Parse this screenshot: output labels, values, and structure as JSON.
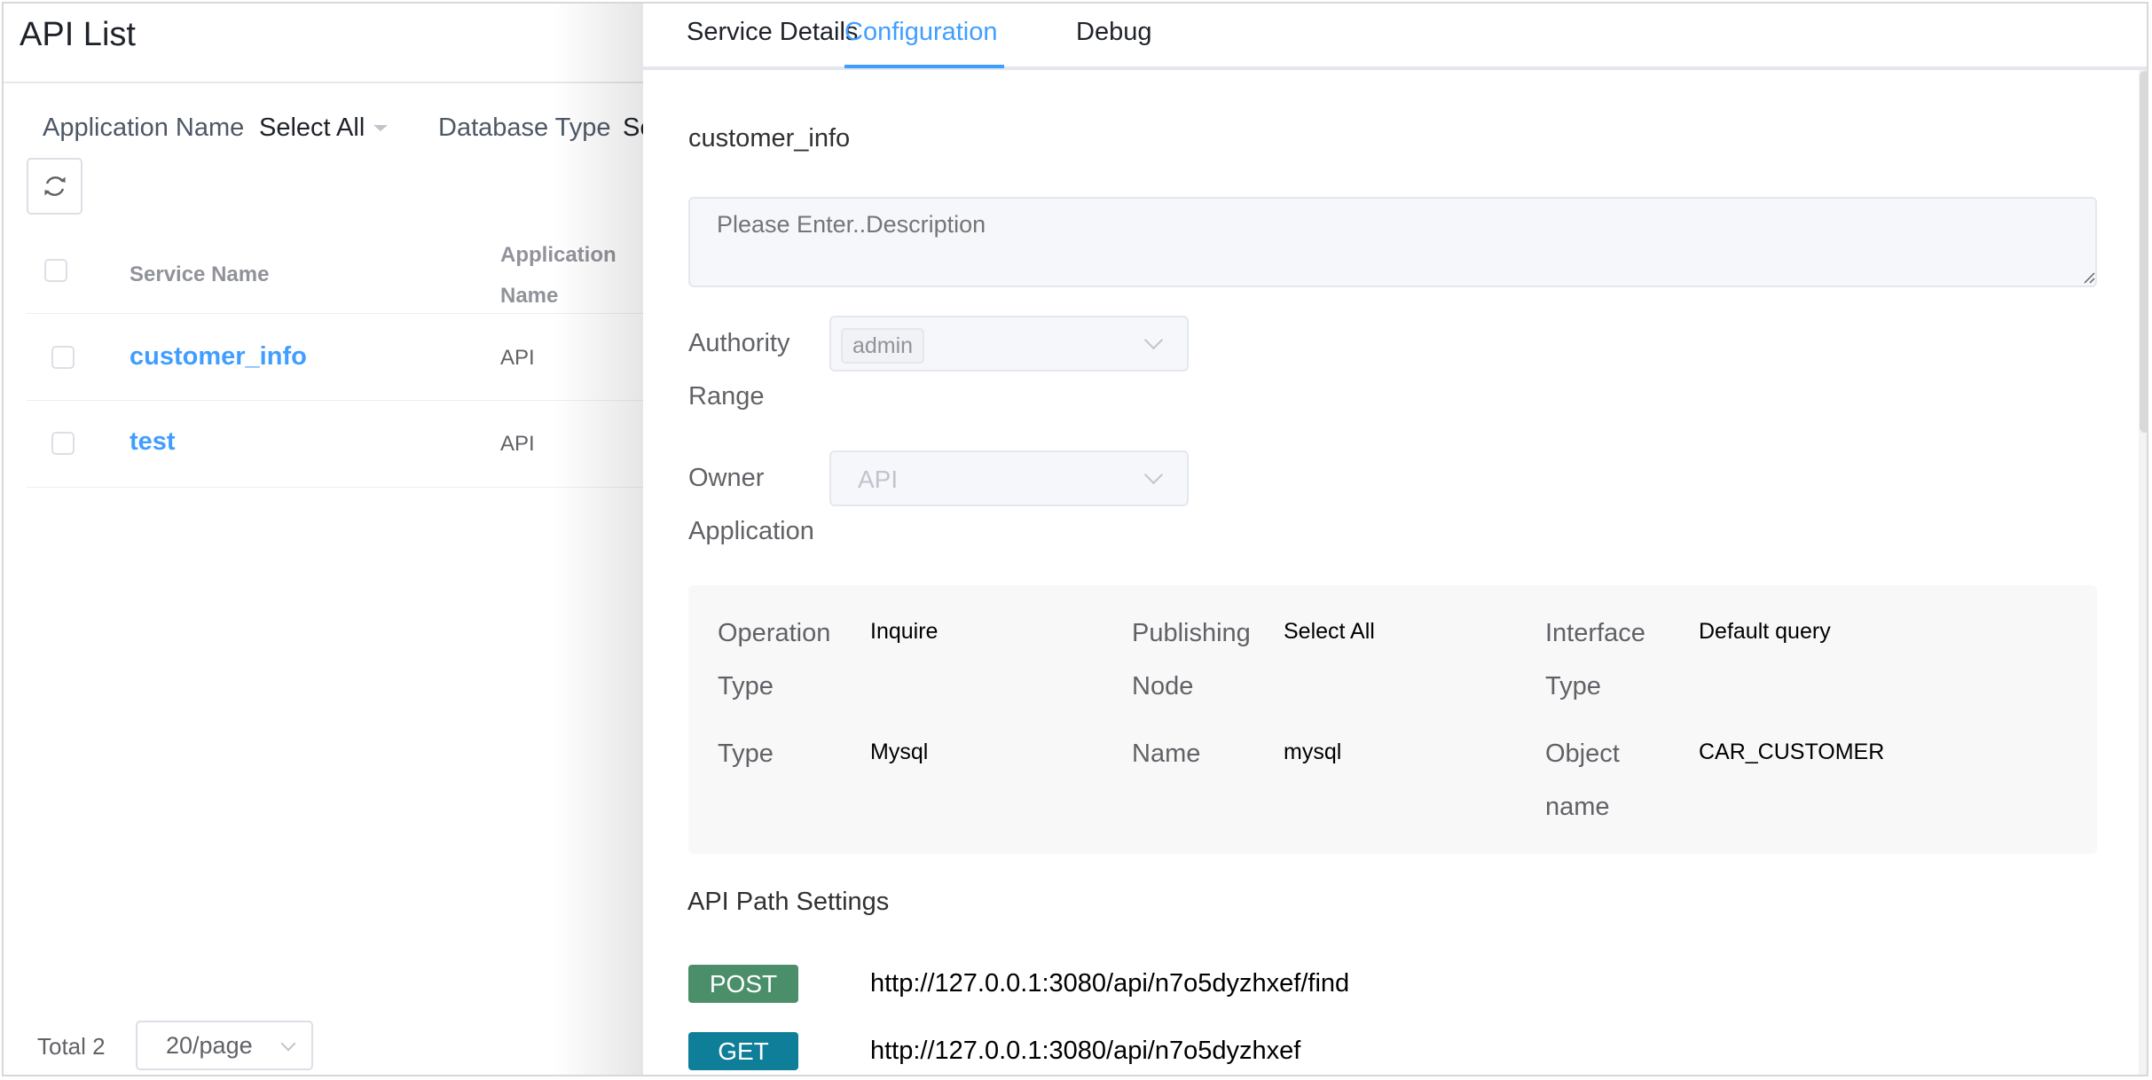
{
  "list_page": {
    "title": "API List",
    "filters": [
      {
        "label": "Application Name",
        "value": "Select All"
      },
      {
        "label": "Database Type",
        "value": "Se"
      }
    ],
    "refresh_icon": "refresh-icon",
    "table": {
      "headers": {
        "service_name": "Service Name",
        "application_name_line1": "Application",
        "application_name_line2": "Name"
      },
      "rows": [
        {
          "service_name": "customer_info",
          "application_name": "API"
        },
        {
          "service_name": "test",
          "application_name": "API"
        }
      ]
    },
    "pagination": {
      "total": "Total 2",
      "page_size": "20/page"
    }
  },
  "drawer": {
    "tabs": [
      {
        "label": "Service Details",
        "active": false
      },
      {
        "label": "Configuration",
        "active": true
      },
      {
        "label": "Debug",
        "active": false
      }
    ],
    "service_title": "customer_info",
    "description": {
      "value": "",
      "placeholder": "Please Enter..Description"
    },
    "authority_range": {
      "label_line1": "Authority",
      "label_line2": "Range",
      "tags": [
        "admin"
      ]
    },
    "owner_application": {
      "label_line1": "Owner",
      "label_line2": "Application",
      "value": "API"
    },
    "info": [
      {
        "label_line1": "Operation",
        "label_line2": "Type",
        "value": "Inquire"
      },
      {
        "label_line1": "Publishing",
        "label_line2": "Node",
        "value": "Select All"
      },
      {
        "label_line1": "Interface",
        "label_line2": "Type",
        "value": "Default query"
      },
      {
        "label_line1": "Type",
        "label_line2": "",
        "value": "Mysql"
      },
      {
        "label_line1": "Name",
        "label_line2": "",
        "value": "mysql"
      },
      {
        "label_line1": "Object",
        "label_line2": "name",
        "value": "CAR_CUSTOMER"
      }
    ],
    "api_path": {
      "title": "API Path Settings",
      "paths": [
        {
          "method": "POST",
          "url": "http://127.0.0.1:3080/api/n7o5dyzhxef/find",
          "color": "#4b8f6a"
        },
        {
          "method": "GET",
          "url": "http://127.0.0.1:3080/api/n7o5dyzhxef",
          "color": "#0e7e99"
        }
      ]
    }
  },
  "colors": {
    "accent": "#409eff",
    "post": "#4b8f6a",
    "get": "#0e7e99"
  }
}
